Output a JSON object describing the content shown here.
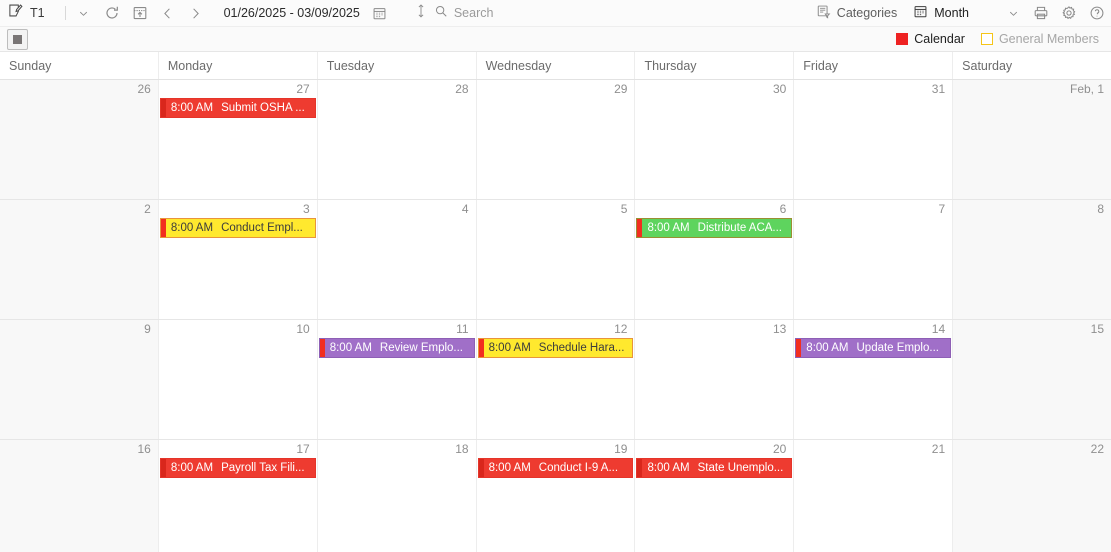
{
  "toolbar": {
    "doc_tab_label": "T1",
    "doc_tab_icon": "note-edit-icon",
    "dropdown_icon": "chevron-down-icon",
    "refresh_icon": "refresh-icon",
    "today_icon": "today-calendar-icon",
    "prev_icon": "chevron-left-icon",
    "next_icon": "chevron-right-icon",
    "date_range": "01/26/2025 - 03/09/2025",
    "date_picker_icon": "calendar-icon",
    "sort_icon": "sort-vertical-icon",
    "search_icon": "search-icon",
    "search_value": "",
    "search_placeholder": "Search",
    "categories_label": "Categories",
    "categories_icon": "categories-filter-icon",
    "view_label": "Month",
    "view_icon": "calendar-month-icon",
    "view_dropdown_icon": "chevron-down-icon",
    "print_icon": "printer-icon",
    "settings_icon": "gear-icon",
    "help_icon": "help-circle-icon"
  },
  "subbar": {
    "toggle_icon": "square-filled-icon",
    "legend": [
      {
        "label": "Calendar",
        "color": "#ee2222",
        "filled": true,
        "state": "active"
      },
      {
        "label": "General Members",
        "color": "#f5c518",
        "filled": false,
        "state": "inactive"
      }
    ]
  },
  "calendar": {
    "day_headers": [
      "Sunday",
      "Monday",
      "Tuesday",
      "Wednesday",
      "Thursday",
      "Friday",
      "Saturday"
    ],
    "weeks": [
      {
        "days": [
          {
            "date": "26",
            "weekend": true,
            "events": []
          },
          {
            "date": "27",
            "weekend": false,
            "events": [
              {
                "time": "8:00 AM",
                "title": "Submit OSHA ...",
                "bg": "#ee3b30",
                "fg": "#ffffff",
                "bar": "#d9271c",
                "border": "#e5352a"
              }
            ]
          },
          {
            "date": "28",
            "weekend": false,
            "events": []
          },
          {
            "date": "29",
            "weekend": false,
            "events": []
          },
          {
            "date": "30",
            "weekend": false,
            "events": []
          },
          {
            "date": "31",
            "weekend": false,
            "events": []
          },
          {
            "date": "Feb, 1",
            "weekend": true,
            "events": []
          }
        ]
      },
      {
        "days": [
          {
            "date": "2",
            "weekend": true,
            "events": []
          },
          {
            "date": "3",
            "weekend": false,
            "events": [
              {
                "time": "8:00 AM",
                "title": "Conduct Empl...",
                "bg": "#ffe92e",
                "fg": "#3c3c3c",
                "bar": "#f22e1f",
                "border": "#e8953a"
              }
            ]
          },
          {
            "date": "4",
            "weekend": false,
            "events": []
          },
          {
            "date": "5",
            "weekend": false,
            "events": []
          },
          {
            "date": "6",
            "weekend": false,
            "events": [
              {
                "time": "8:00 AM",
                "title": "Distribute ACA...",
                "bg": "#5ed45e",
                "fg": "#ffffff",
                "bar": "#f22e1f",
                "border": "#9a8f33"
              }
            ]
          },
          {
            "date": "7",
            "weekend": false,
            "events": []
          },
          {
            "date": "8",
            "weekend": true,
            "events": []
          }
        ]
      },
      {
        "days": [
          {
            "date": "9",
            "weekend": true,
            "events": []
          },
          {
            "date": "10",
            "weekend": false,
            "events": []
          },
          {
            "date": "11",
            "weekend": false,
            "events": [
              {
                "time": "8:00 AM",
                "title": "Review Emplo...",
                "bg": "#a06fc8",
                "fg": "#ffffff",
                "bar": "#f22e1f",
                "border": "#8e5fb5"
              }
            ]
          },
          {
            "date": "12",
            "weekend": false,
            "events": [
              {
                "time": "8:00 AM",
                "title": "Schedule Hara...",
                "bg": "#ffe92e",
                "fg": "#3c3c3c",
                "bar": "#f22e1f",
                "border": "#e8953a"
              }
            ]
          },
          {
            "date": "13",
            "weekend": false,
            "events": []
          },
          {
            "date": "14",
            "weekend": false,
            "events": [
              {
                "time": "8:00 AM",
                "title": "Update Emplo...",
                "bg": "#a06fc8",
                "fg": "#ffffff",
                "bar": "#f22e1f",
                "border": "#8e5fb5"
              }
            ]
          },
          {
            "date": "15",
            "weekend": true,
            "events": []
          }
        ]
      },
      {
        "days": [
          {
            "date": "16",
            "weekend": true,
            "events": []
          },
          {
            "date": "17",
            "weekend": false,
            "events": [
              {
                "time": "8:00 AM",
                "title": "Payroll Tax Fili...",
                "bg": "#ee3b30",
                "fg": "#ffffff",
                "bar": "#d9271c",
                "border": "#e5352a"
              }
            ]
          },
          {
            "date": "18",
            "weekend": false,
            "events": []
          },
          {
            "date": "19",
            "weekend": false,
            "events": [
              {
                "time": "8:00 AM",
                "title": "Conduct I-9 A...",
                "bg": "#ee3b30",
                "fg": "#ffffff",
                "bar": "#d9271c",
                "border": "#e5352a"
              }
            ]
          },
          {
            "date": "20",
            "weekend": false,
            "events": [
              {
                "time": "8:00 AM",
                "title": "State Unemplo...",
                "bg": "#ee3b30",
                "fg": "#ffffff",
                "bar": "#d9271c",
                "border": "#e5352a"
              }
            ]
          },
          {
            "date": "21",
            "weekend": false,
            "events": []
          },
          {
            "date": "22",
            "weekend": true,
            "events": []
          }
        ]
      }
    ]
  }
}
